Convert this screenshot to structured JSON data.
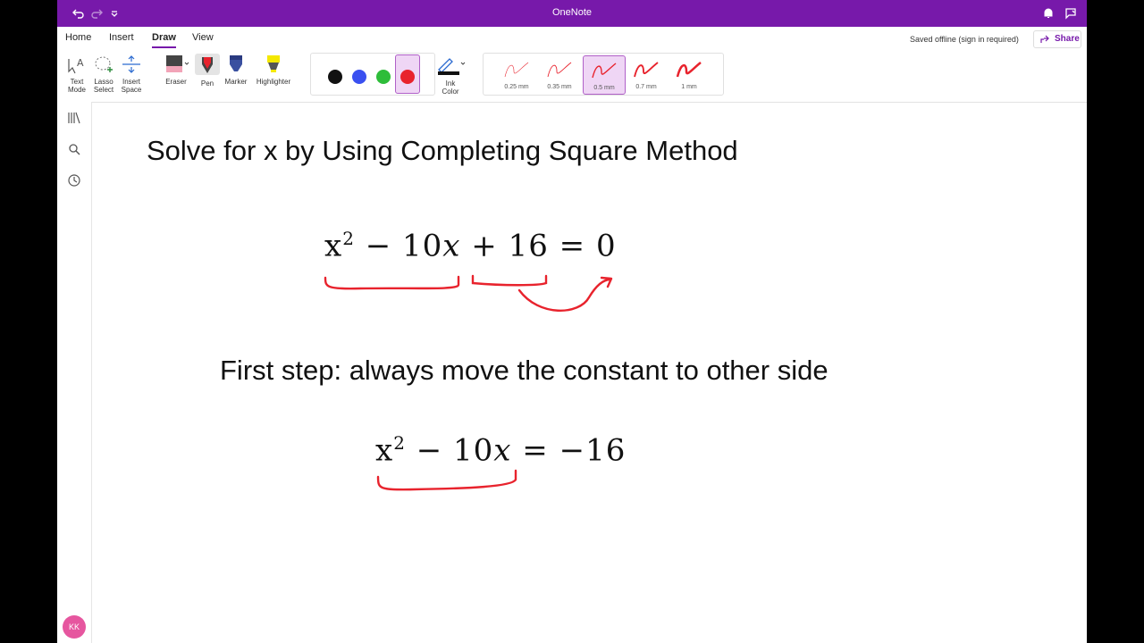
{
  "app": {
    "title": "OneNote"
  },
  "tabs": [
    "Home",
    "Insert",
    "Draw",
    "View"
  ],
  "status": {
    "save_text": "Saved offline (sign in required)",
    "share_label": "Share"
  },
  "ribbon": {
    "tools": [
      {
        "label1": "Text",
        "label2": "Mode"
      },
      {
        "label1": "Lasso",
        "label2": "Select"
      },
      {
        "label1": "Insert",
        "label2": "Space"
      }
    ],
    "pens": [
      "Eraser",
      "Pen",
      "Marker",
      "Highlighter"
    ],
    "colors": [
      "#111111",
      "#3a50f0",
      "#2ebd3a",
      "#e8232d"
    ],
    "ink_color": {
      "label1": "Ink",
      "label2": "Color"
    },
    "thickness": [
      "0.25 mm",
      "0.35 mm",
      "0.5 mm",
      "0.7 mm",
      "1 mm"
    ],
    "selected_thickness": "0.5 mm"
  },
  "user": {
    "initials": "KK"
  },
  "page": {
    "heading": "Solve for x by Using Completing Square Method",
    "equation1": {
      "x": "x",
      "exp": "2",
      "rest1": " − 10",
      "var": "x",
      "rest2": " + 16 = 0"
    },
    "step_text": "First step: always move the constant to other side",
    "equation2": {
      "x": "x",
      "exp": "2",
      "rest1": " − 10",
      "var": "x",
      "rest2": " = −16"
    }
  },
  "ink_color": "#e8232d"
}
